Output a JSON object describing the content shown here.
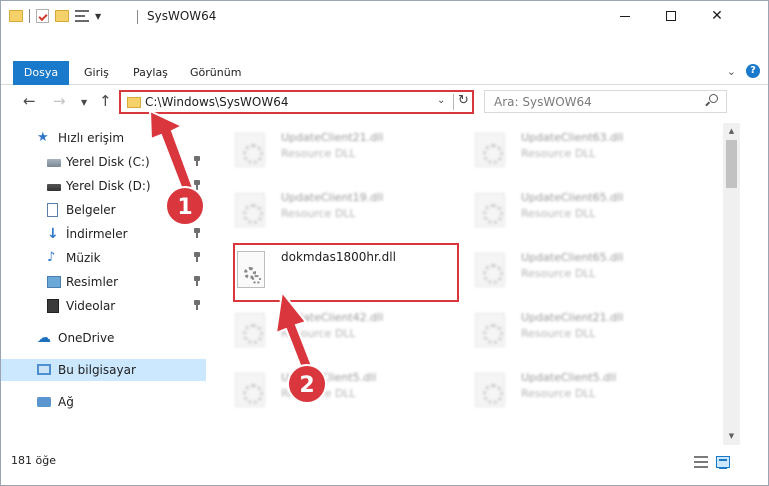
{
  "window": {
    "title": "SysWOW64"
  },
  "ribbon": {
    "tabs": {
      "file": "Dosya",
      "home": "Giriş",
      "share": "Paylaş",
      "view": "Görünüm"
    },
    "help": "?"
  },
  "address": {
    "path": "C:\\Windows\\SysWOW64"
  },
  "search": {
    "placeholder": "Ara: SysWOW64"
  },
  "sidebar": {
    "items": [
      {
        "label": "Hızlı erişim",
        "icon": "star-icon"
      },
      {
        "label": "Yerel Disk (C:)",
        "icon": "disk-icon"
      },
      {
        "label": "Yerel Disk (D:)",
        "icon": "disk-icon"
      },
      {
        "label": "Belgeler",
        "icon": "documents-icon"
      },
      {
        "label": "İndirmeler",
        "icon": "download-icon"
      },
      {
        "label": "Müzik",
        "icon": "music-icon"
      },
      {
        "label": "Resimler",
        "icon": "pictures-icon"
      },
      {
        "label": "Videolar",
        "icon": "videos-icon"
      },
      {
        "label": "OneDrive",
        "icon": "cloud-icon"
      },
      {
        "label": "Bu bilgisayar",
        "icon": "computer-icon"
      },
      {
        "label": "Ağ",
        "icon": "network-icon"
      }
    ]
  },
  "files": {
    "highlighted": {
      "name": "dokmdas1800hr.dll"
    },
    "left": [
      {
        "name": "UpdateClient21.dll",
        "type": "Resource DLL"
      },
      {
        "name": "UpdateClient19.dll",
        "type": "Resource DLL"
      },
      {
        "name": "UpdateClient42.dll",
        "type": "Resource DLL"
      },
      {
        "name": "UpdateClient5.dll",
        "type": "Resource DLL"
      }
    ],
    "right": [
      {
        "name": "UpdateClient63.dll",
        "type": "Resource DLL"
      },
      {
        "name": "UpdateClient65.dll",
        "type": "Resource DLL"
      },
      {
        "name": "UpdateClient65.dll",
        "type": "Resource DLL"
      },
      {
        "name": "UpdateClient21.dll",
        "type": "Resource DLL"
      },
      {
        "name": "UpdateClient5.dll",
        "type": "Resource DLL"
      }
    ]
  },
  "status": {
    "count": "181 öğe"
  },
  "annotations": {
    "step1": "1",
    "step2": "2",
    "color": "#d9363e"
  }
}
